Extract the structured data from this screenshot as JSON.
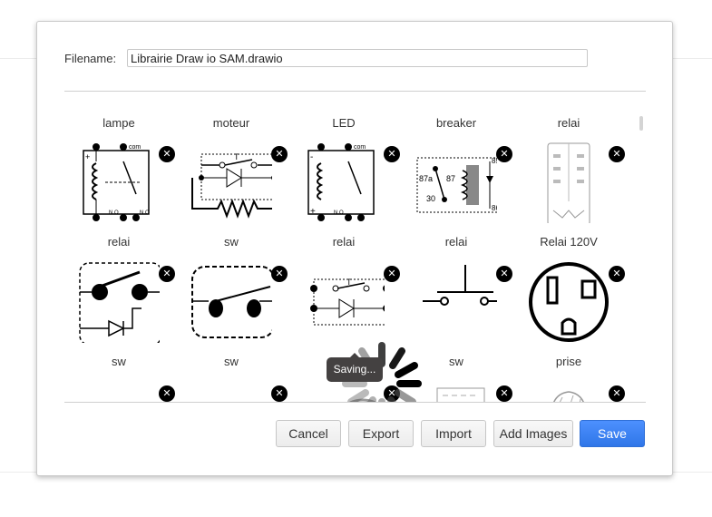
{
  "dialog": {
    "filename_label": "Filename:",
    "filename_value": "Librairie Draw io SAM.drawio"
  },
  "library": {
    "rows": [
      [
        {
          "label": "lampe",
          "icon": "lamp-symbol"
        },
        {
          "label": "moteur",
          "icon": "motor-symbol"
        },
        {
          "label": "LED",
          "icon": "led-symbol"
        },
        {
          "label": "breaker",
          "icon": "breaker-symbol"
        },
        {
          "label": "relai",
          "icon": "relay-symbol"
        }
      ],
      [
        {
          "label": "relai",
          "icon": "relay-symbol"
        },
        {
          "label": "sw",
          "icon": "switch-symbol"
        },
        {
          "label": "relai",
          "icon": "relay-symbol"
        },
        {
          "label": "relai",
          "icon": "relay-symbol"
        },
        {
          "label": "Relai 120V",
          "icon": "relay-socket-symbol"
        }
      ],
      [
        {
          "label": "sw",
          "icon": "switch-symbol"
        },
        {
          "label": "sw",
          "icon": "switch-symbol"
        },
        {
          "label": "",
          "icon": "switch-symbol"
        },
        {
          "label": "sw",
          "icon": "pushbutton-symbol"
        },
        {
          "label": "prise",
          "icon": "outlet-symbol"
        }
      ],
      [
        {
          "label": "",
          "icon": "shape"
        },
        {
          "label": "",
          "icon": "shape"
        },
        {
          "label": "",
          "icon": "shape"
        },
        {
          "label": "",
          "icon": "shape"
        },
        {
          "label": "",
          "icon": "shape"
        }
      ]
    ],
    "delete_symbol": "✕"
  },
  "toast": {
    "text": "Saving..."
  },
  "buttons": {
    "cancel": "Cancel",
    "export": "Export",
    "import": "Import",
    "add_images": "Add Images",
    "save": "Save"
  },
  "colors": {
    "primary": "#3b82f0",
    "toast_bg": "#444141"
  }
}
